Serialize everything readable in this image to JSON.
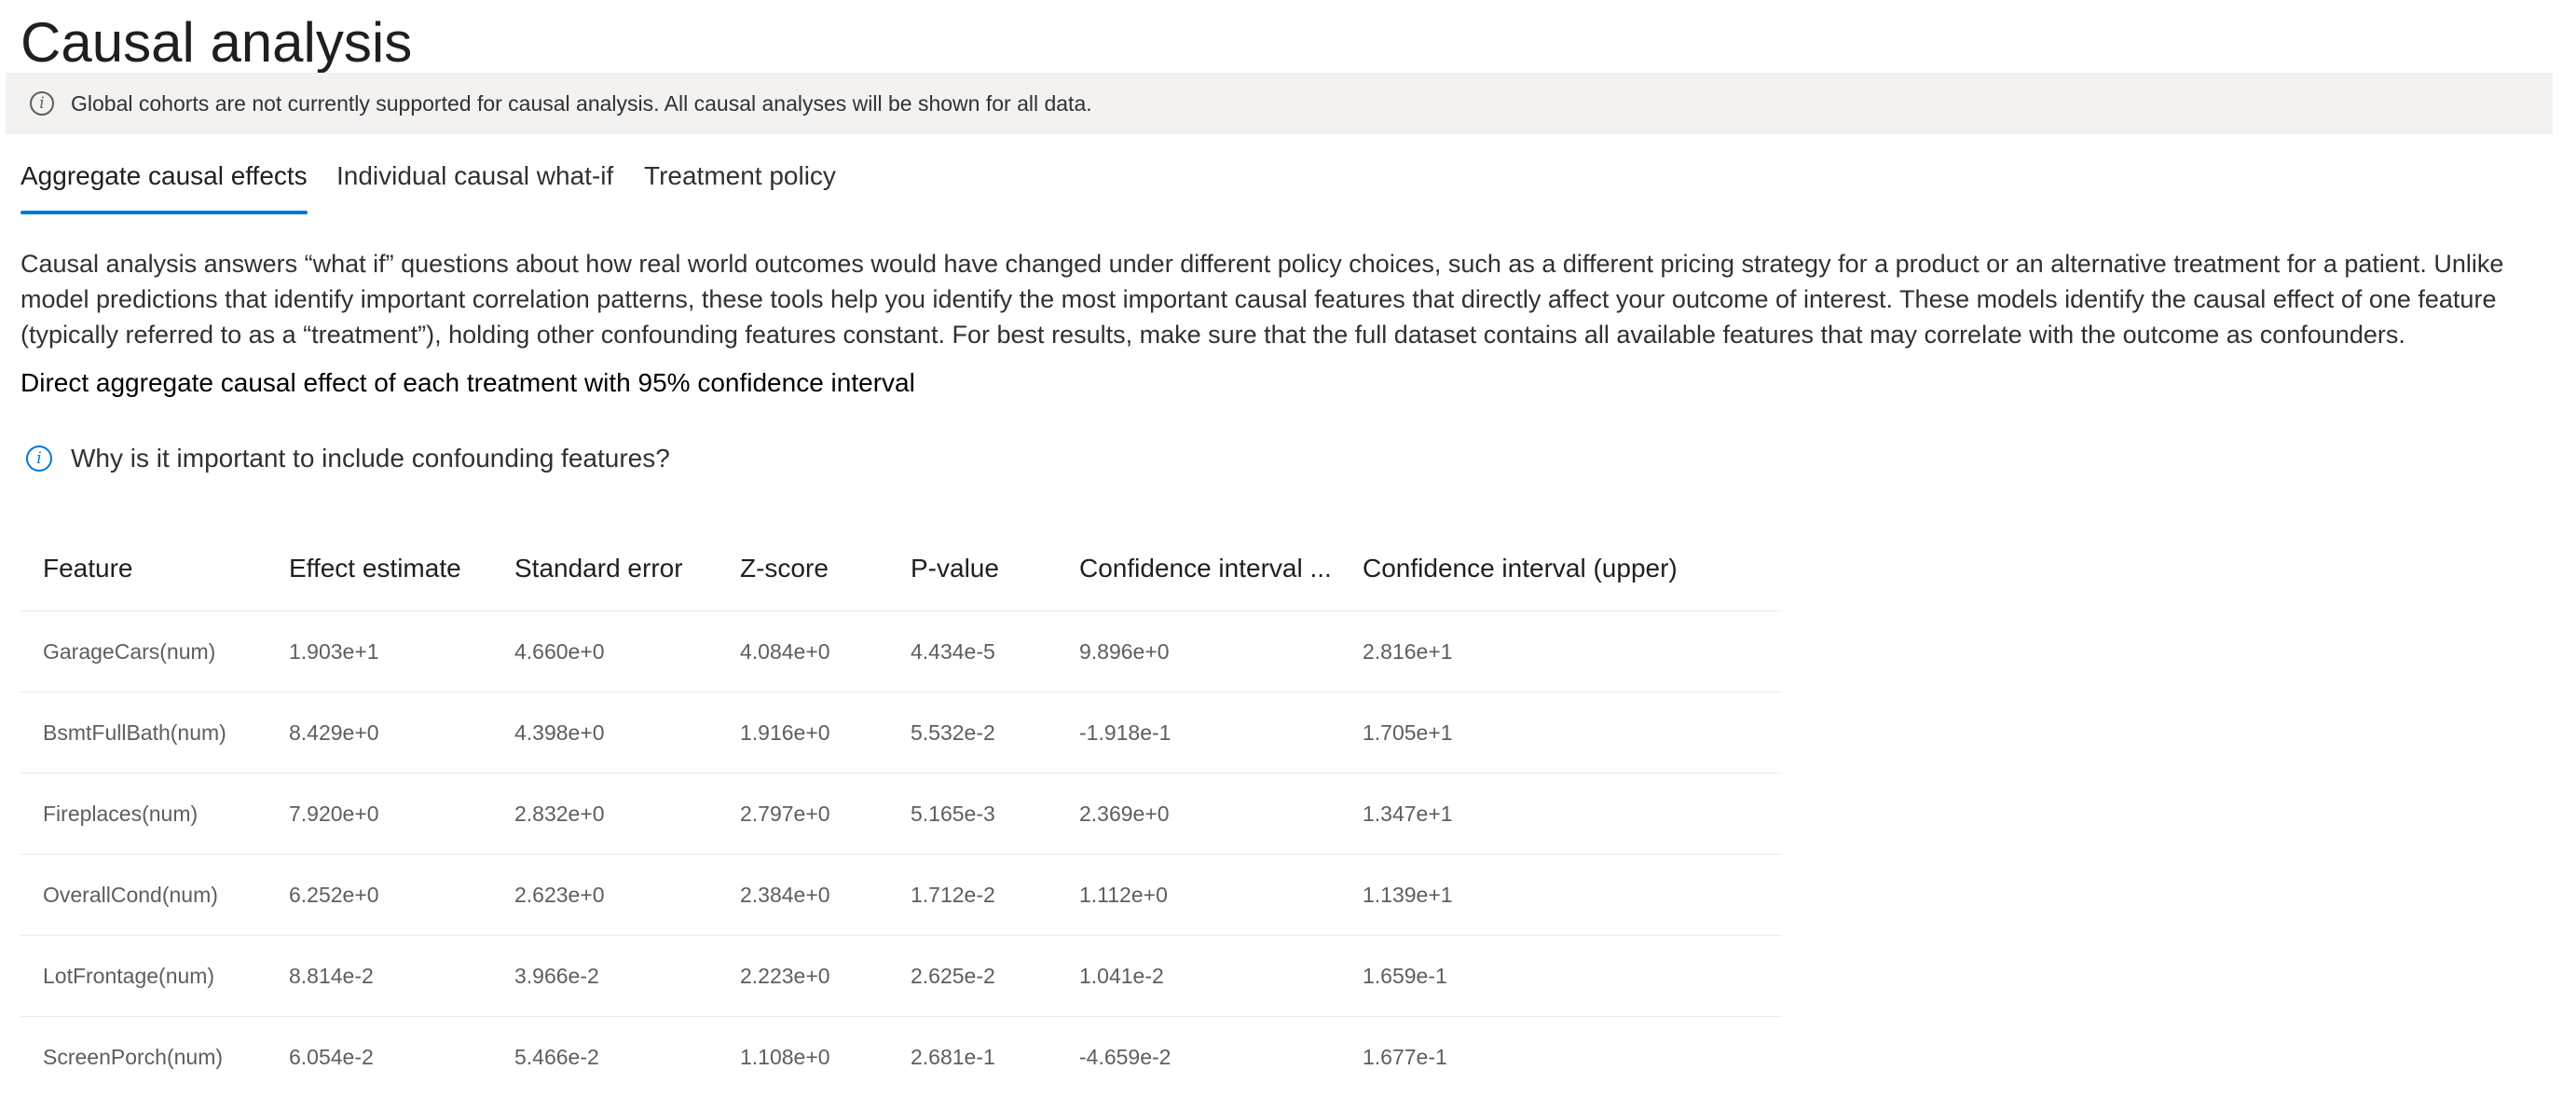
{
  "page": {
    "title": "Causal analysis"
  },
  "info_bar": {
    "icon": "info-icon",
    "message": "Global cohorts are not currently supported for causal analysis. All causal analyses will be shown for all data."
  },
  "tabs": [
    {
      "label": "Aggregate causal effects",
      "selected": true
    },
    {
      "label": "Individual causal what-if",
      "selected": false
    },
    {
      "label": "Treatment policy",
      "selected": false
    }
  ],
  "description": "Causal analysis answers “what if” questions about how real world outcomes would have changed under different policy choices, such as a different pricing strategy for a product or an alternative treatment for a patient. Unlike model predictions that identify important correlation patterns, these tools help you identify the most important causal features that directly affect your outcome of interest. These models identify the causal effect of one feature (typically referred to as a “treatment”), holding other confounding features constant. For best results, make sure that the full dataset contains all available features that may correlate with the outcome as confounders.",
  "subheading": "Direct aggregate causal effect of each treatment with 95% confidence interval",
  "why_link": {
    "icon": "info-icon",
    "label": "Why is it important to include confounding features?"
  },
  "table": {
    "columns": [
      "Feature",
      "Effect estimate",
      "Standard error",
      "Z-score",
      "P-value",
      "Confidence interval ...",
      "Confidence interval (upper)"
    ],
    "rows": [
      [
        "GarageCars(num)",
        "1.903e+1",
        "4.660e+0",
        "4.084e+0",
        "4.434e-5",
        "9.896e+0",
        "2.816e+1"
      ],
      [
        "BsmtFullBath(num)",
        "8.429e+0",
        "4.398e+0",
        "1.916e+0",
        "5.532e-2",
        "-1.918e-1",
        "1.705e+1"
      ],
      [
        "Fireplaces(num)",
        "7.920e+0",
        "2.832e+0",
        "2.797e+0",
        "5.165e-3",
        "2.369e+0",
        "1.347e+1"
      ],
      [
        "OverallCond(num)",
        "6.252e+0",
        "2.623e+0",
        "2.384e+0",
        "1.712e-2",
        "1.112e+0",
        "1.139e+1"
      ],
      [
        "LotFrontage(num)",
        "8.814e-2",
        "3.966e-2",
        "2.223e+0",
        "2.625e-2",
        "1.041e-2",
        "1.659e-1"
      ],
      [
        "ScreenPorch(num)",
        "6.054e-2",
        "5.466e-2",
        "1.108e+0",
        "2.681e-1",
        "-4.659e-2",
        "1.677e-1"
      ]
    ]
  },
  "colors": {
    "accent": "#0078d4",
    "info_bar_bg": "#f3f2f1",
    "row_divider": "#edebe9",
    "cell_text": "#605e5c"
  }
}
